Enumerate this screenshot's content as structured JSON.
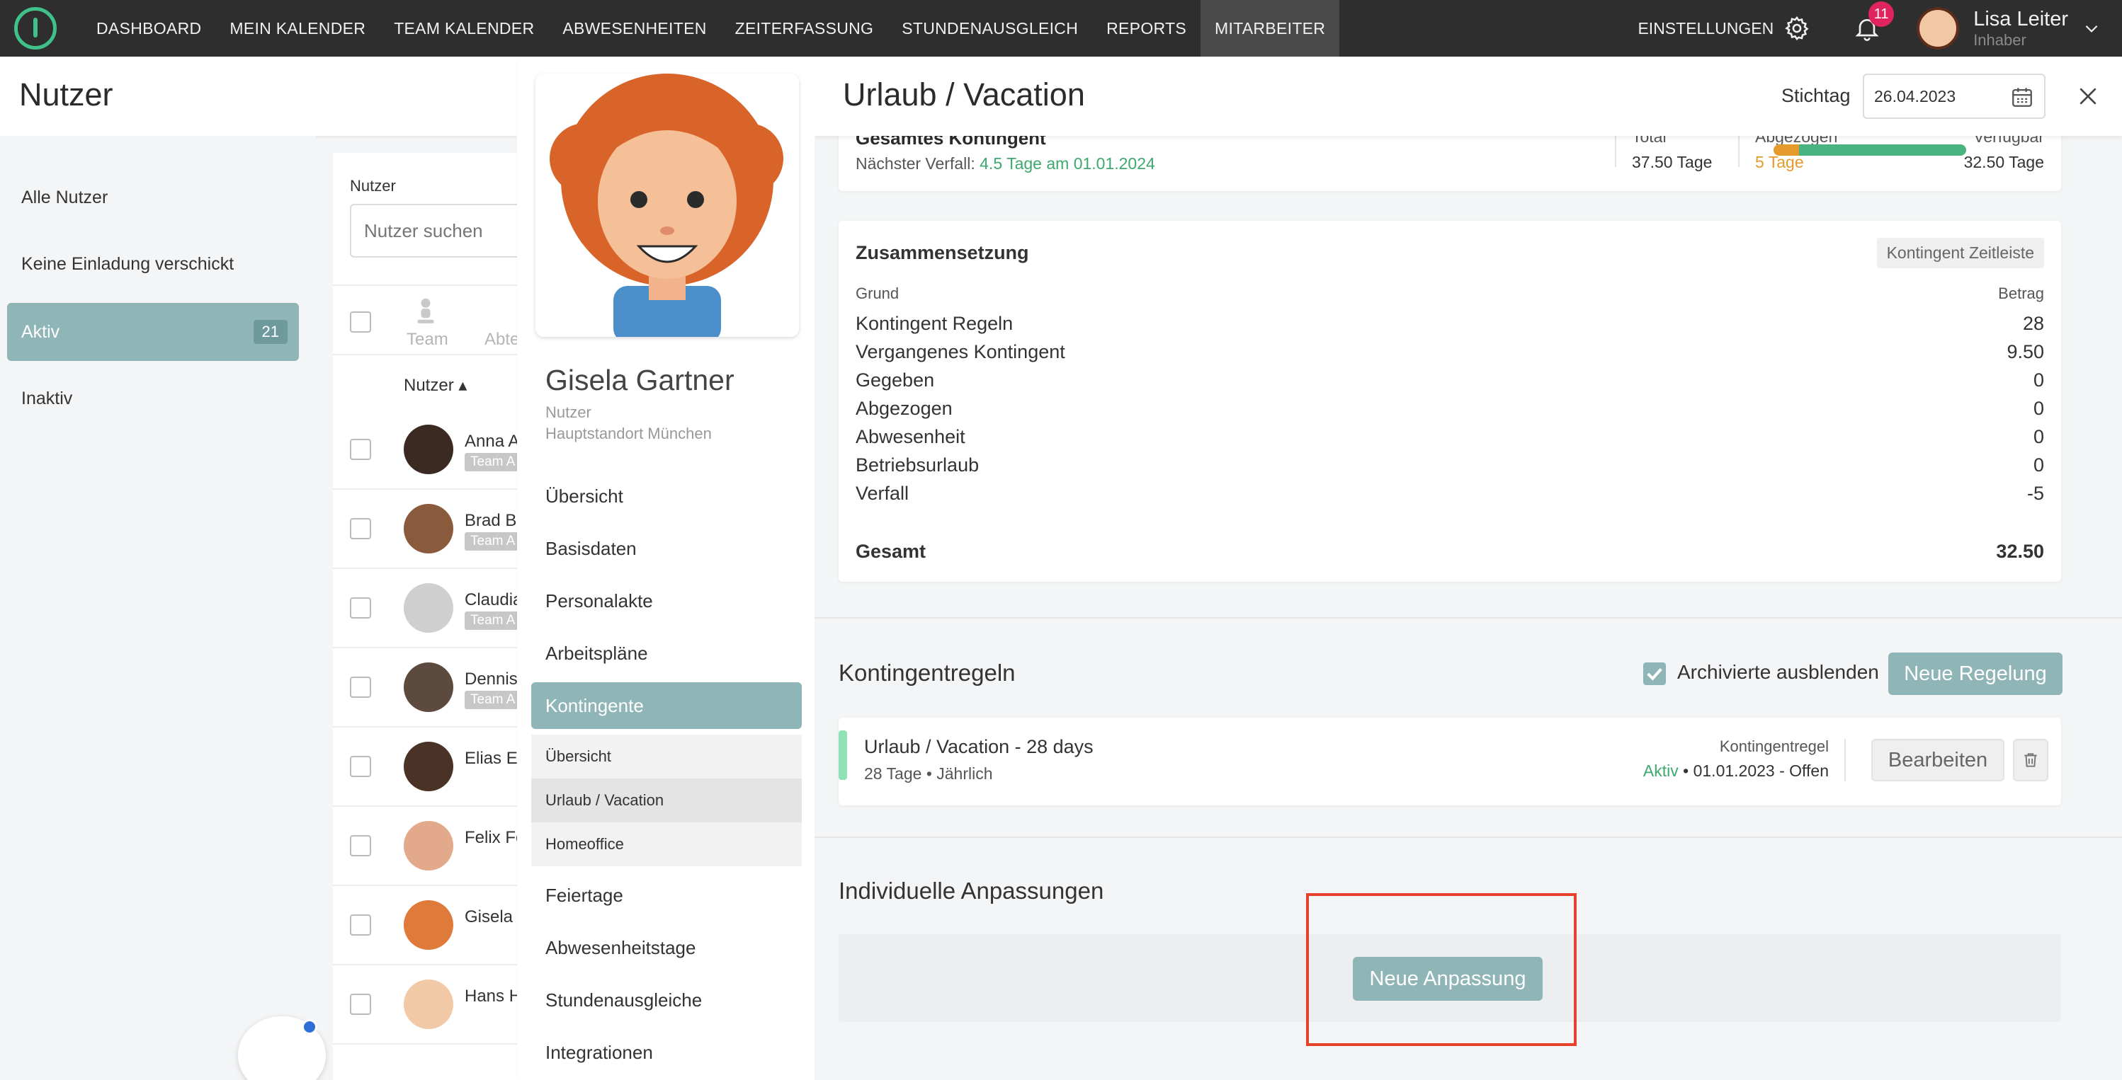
{
  "topnav": {
    "items": [
      "DASHBOARD",
      "MEIN KALENDER",
      "TEAM KALENDER",
      "ABWESENHEITEN",
      "ZEITERFASSUNG",
      "STUNDENAUSGLEICH",
      "REPORTS",
      "MITARBEITER"
    ],
    "active": "MITARBEITER",
    "settings_label": "EINSTELLUNGEN",
    "notification_count": "11",
    "user_name": "Lisa Leiter",
    "user_role": "Inhaber"
  },
  "left": {
    "title": "Nutzer",
    "sidebar": [
      {
        "label": "Alle Nutzer",
        "count": ""
      },
      {
        "label": "Keine Einladung verschickt",
        "count": ""
      },
      {
        "label": "Aktiv",
        "count": "21"
      },
      {
        "label": "Inaktiv",
        "count": ""
      }
    ],
    "search_label": "Nutzer",
    "search_placeholder": "Nutzer suchen",
    "filter_team": "Team",
    "filter_abt": "Abte",
    "column_user": "Nutzer ▴",
    "users": [
      {
        "name": "Anna A",
        "team": "Team A"
      },
      {
        "name": "Brad Bo",
        "team": "Team A"
      },
      {
        "name": "Claudia",
        "team": "Team A"
      },
      {
        "name": "Dennis",
        "team": "Team A"
      },
      {
        "name": "Elias Er",
        "team": ""
      },
      {
        "name": "Felix Fe",
        "team": ""
      },
      {
        "name": "Gisela",
        "team": ""
      },
      {
        "name": "Hans H",
        "team": ""
      }
    ]
  },
  "employee": {
    "name": "Gisela Gartner",
    "role": "Nutzer",
    "location": "Hauptstandort München",
    "menu": [
      "Übersicht",
      "Basisdaten",
      "Personalakte",
      "Arbeitspläne",
      "Kontingente"
    ],
    "submenu": [
      "Übersicht",
      "Urlaub / Vacation",
      "Homeoffice"
    ],
    "menu_after": [
      "Feiertage",
      "Abwesenheitstage",
      "Stundenausgleiche",
      "Integrationen"
    ]
  },
  "main": {
    "title": "Urlaub / Vacation",
    "stichtag_label": "Stichtag",
    "stichtag_value": "26.04.2023",
    "kontingent": {
      "title": "Gesamtes Kontingent",
      "next_label": "Nächster Verfall:",
      "next_value": "4.5 Tage am 01.01.2024",
      "total_label": "Total",
      "total_value": "37.50 Tage",
      "deducted_label": "Abgezogen",
      "deducted_value": "5 Tage",
      "available_label": "Verfügbar",
      "available_value": "32.50 Tage",
      "used_fraction": 0.133
    },
    "composition": {
      "title": "Zusammensetzung",
      "timeline_button": "Kontingent Zeitleiste",
      "col_reason": "Grund",
      "col_amount": "Betrag",
      "rows": [
        {
          "label": "Kontingent Regeln",
          "value": "28"
        },
        {
          "label": "Vergangenes Kontingent",
          "value": "9.50"
        },
        {
          "label": "Gegeben",
          "value": "0"
        },
        {
          "label": "Abgezogen",
          "value": "0"
        },
        {
          "label": "Abwesenheit",
          "value": "0"
        },
        {
          "label": "Betriebsurlaub",
          "value": "0"
        },
        {
          "label": "Verfall",
          "value": "-5"
        }
      ],
      "total_label": "Gesamt",
      "total_value": "32.50"
    },
    "rules": {
      "title": "Kontingentregeln",
      "archive_label": "Archivierte ausblenden",
      "new_button": "Neue Regelung",
      "item": {
        "title": "Urlaub / Vacation - 28 days",
        "subtitle": "28 Tage • Jährlich",
        "type": "Kontingentregel",
        "status": "Aktiv",
        "period": " • 01.01.2023 - Offen",
        "edit_button": "Bearbeiten"
      }
    },
    "adjustments": {
      "title": "Individuelle Anpassungen",
      "new_button": "Neue Anpassung"
    }
  }
}
